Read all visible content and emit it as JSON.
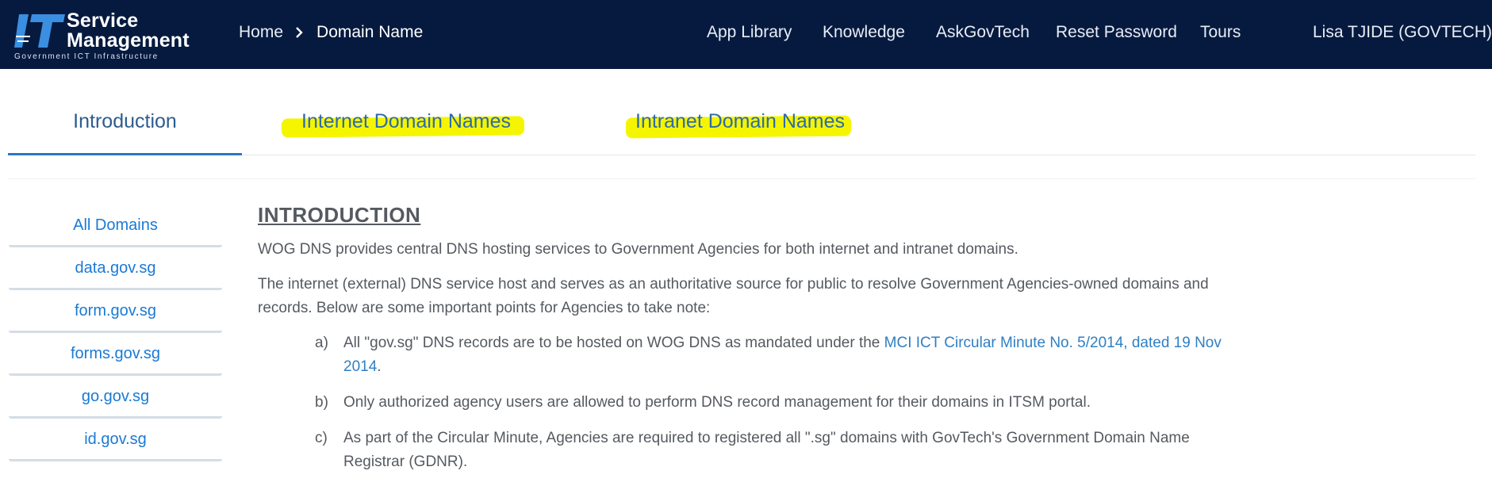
{
  "header": {
    "logo_mark": "IT",
    "logo_line1": "Service",
    "logo_line2": "Management",
    "logo_sub": "Government ICT Infrastructure",
    "breadcrumb": {
      "home": "Home",
      "current": "Domain Name"
    },
    "nav": [
      "App Library",
      "Knowledge",
      "AskGovTech",
      "Reset Password",
      "Tours"
    ],
    "user": "Lisa TJIDE (GOVTECH)"
  },
  "tabs": {
    "intro": "Introduction",
    "internet": "Internet Domain Names",
    "intranet": "Intranet Domain Names"
  },
  "sidebar": {
    "items": [
      "All Domains",
      "data.gov.sg",
      "form.gov.sg",
      "forms.gov.sg",
      "go.gov.sg",
      "id.gov.sg"
    ]
  },
  "content": {
    "heading": "INTRODUCTION",
    "para1": "WOG DNS provides central DNS hosting services to Government Agencies for both internet and intranet domains.",
    "para2": "The internet (external) DNS service host and serves as an authoritative source for public to resolve Government Agencies-owned domains and records.  Below are some important points for Agencies to take note:",
    "list": [
      {
        "marker": "a)",
        "text_before": "All \"gov.sg\" DNS records are to be hosted on WOG DNS as mandated under the ",
        "link": "MCI ICT Circular Minute No. 5/2014, dated 19 Nov 2014",
        "text_after": "."
      },
      {
        "marker": "b)",
        "text": "Only authorized agency users are allowed to perform DNS record management for their domains in ITSM portal."
      },
      {
        "marker": "c)",
        "text": "As part of the Circular Minute, Agencies are required to registered all \".sg\" domains with GovTech's Government Domain Name Registrar (GDNR)."
      }
    ]
  },
  "colors": {
    "header_bg": "#061a3f",
    "active_tab": "#2f76c2",
    "link": "#1a7ad4",
    "highlight": "#f5f500"
  }
}
